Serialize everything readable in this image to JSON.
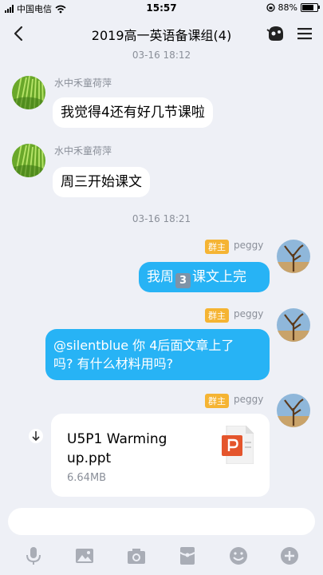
{
  "status_bar": {
    "carrier": "中国电信",
    "time": "15:57",
    "battery": "88%"
  },
  "header": {
    "title": "2019高一英语备课组(4)"
  },
  "messages": [
    {
      "type": "time",
      "text": "03-16 18:12"
    },
    {
      "type": "incoming",
      "sender": "水中禾童荷萍",
      "text": "我觉得4还有好几节课啦"
    },
    {
      "type": "incoming",
      "sender": "水中禾童荷萍",
      "text": "周三开始课文"
    },
    {
      "type": "time",
      "text": "03-16 18:21"
    },
    {
      "type": "outgoing",
      "badge": "群主",
      "sender": "peggy",
      "text_before": "我周",
      "emoji": "3",
      "text_after": "课文上完"
    },
    {
      "type": "outgoing",
      "badge": "群主",
      "sender": "peggy",
      "line1": "@silentblue 你 4后面文章上了",
      "line2": "吗? 有什么材料用吗?"
    },
    {
      "type": "file",
      "badge": "群主",
      "sender": "peggy",
      "name_line1": "U5P1 Warming",
      "name_line2": "up.ppt",
      "size": "6.64MB",
      "icon": "powerpoint-icon"
    }
  ],
  "input_bar": {
    "placeholder": "",
    "tools": [
      "microphone-icon",
      "image-icon",
      "camera-icon",
      "red-packet-icon",
      "emoji-icon",
      "plus-icon"
    ]
  },
  "colors": {
    "background": "#eef0f6",
    "outgoing_bubble": "#27b3f5",
    "owner_badge": "#f5b433",
    "powerpoint": "#e4552c"
  }
}
